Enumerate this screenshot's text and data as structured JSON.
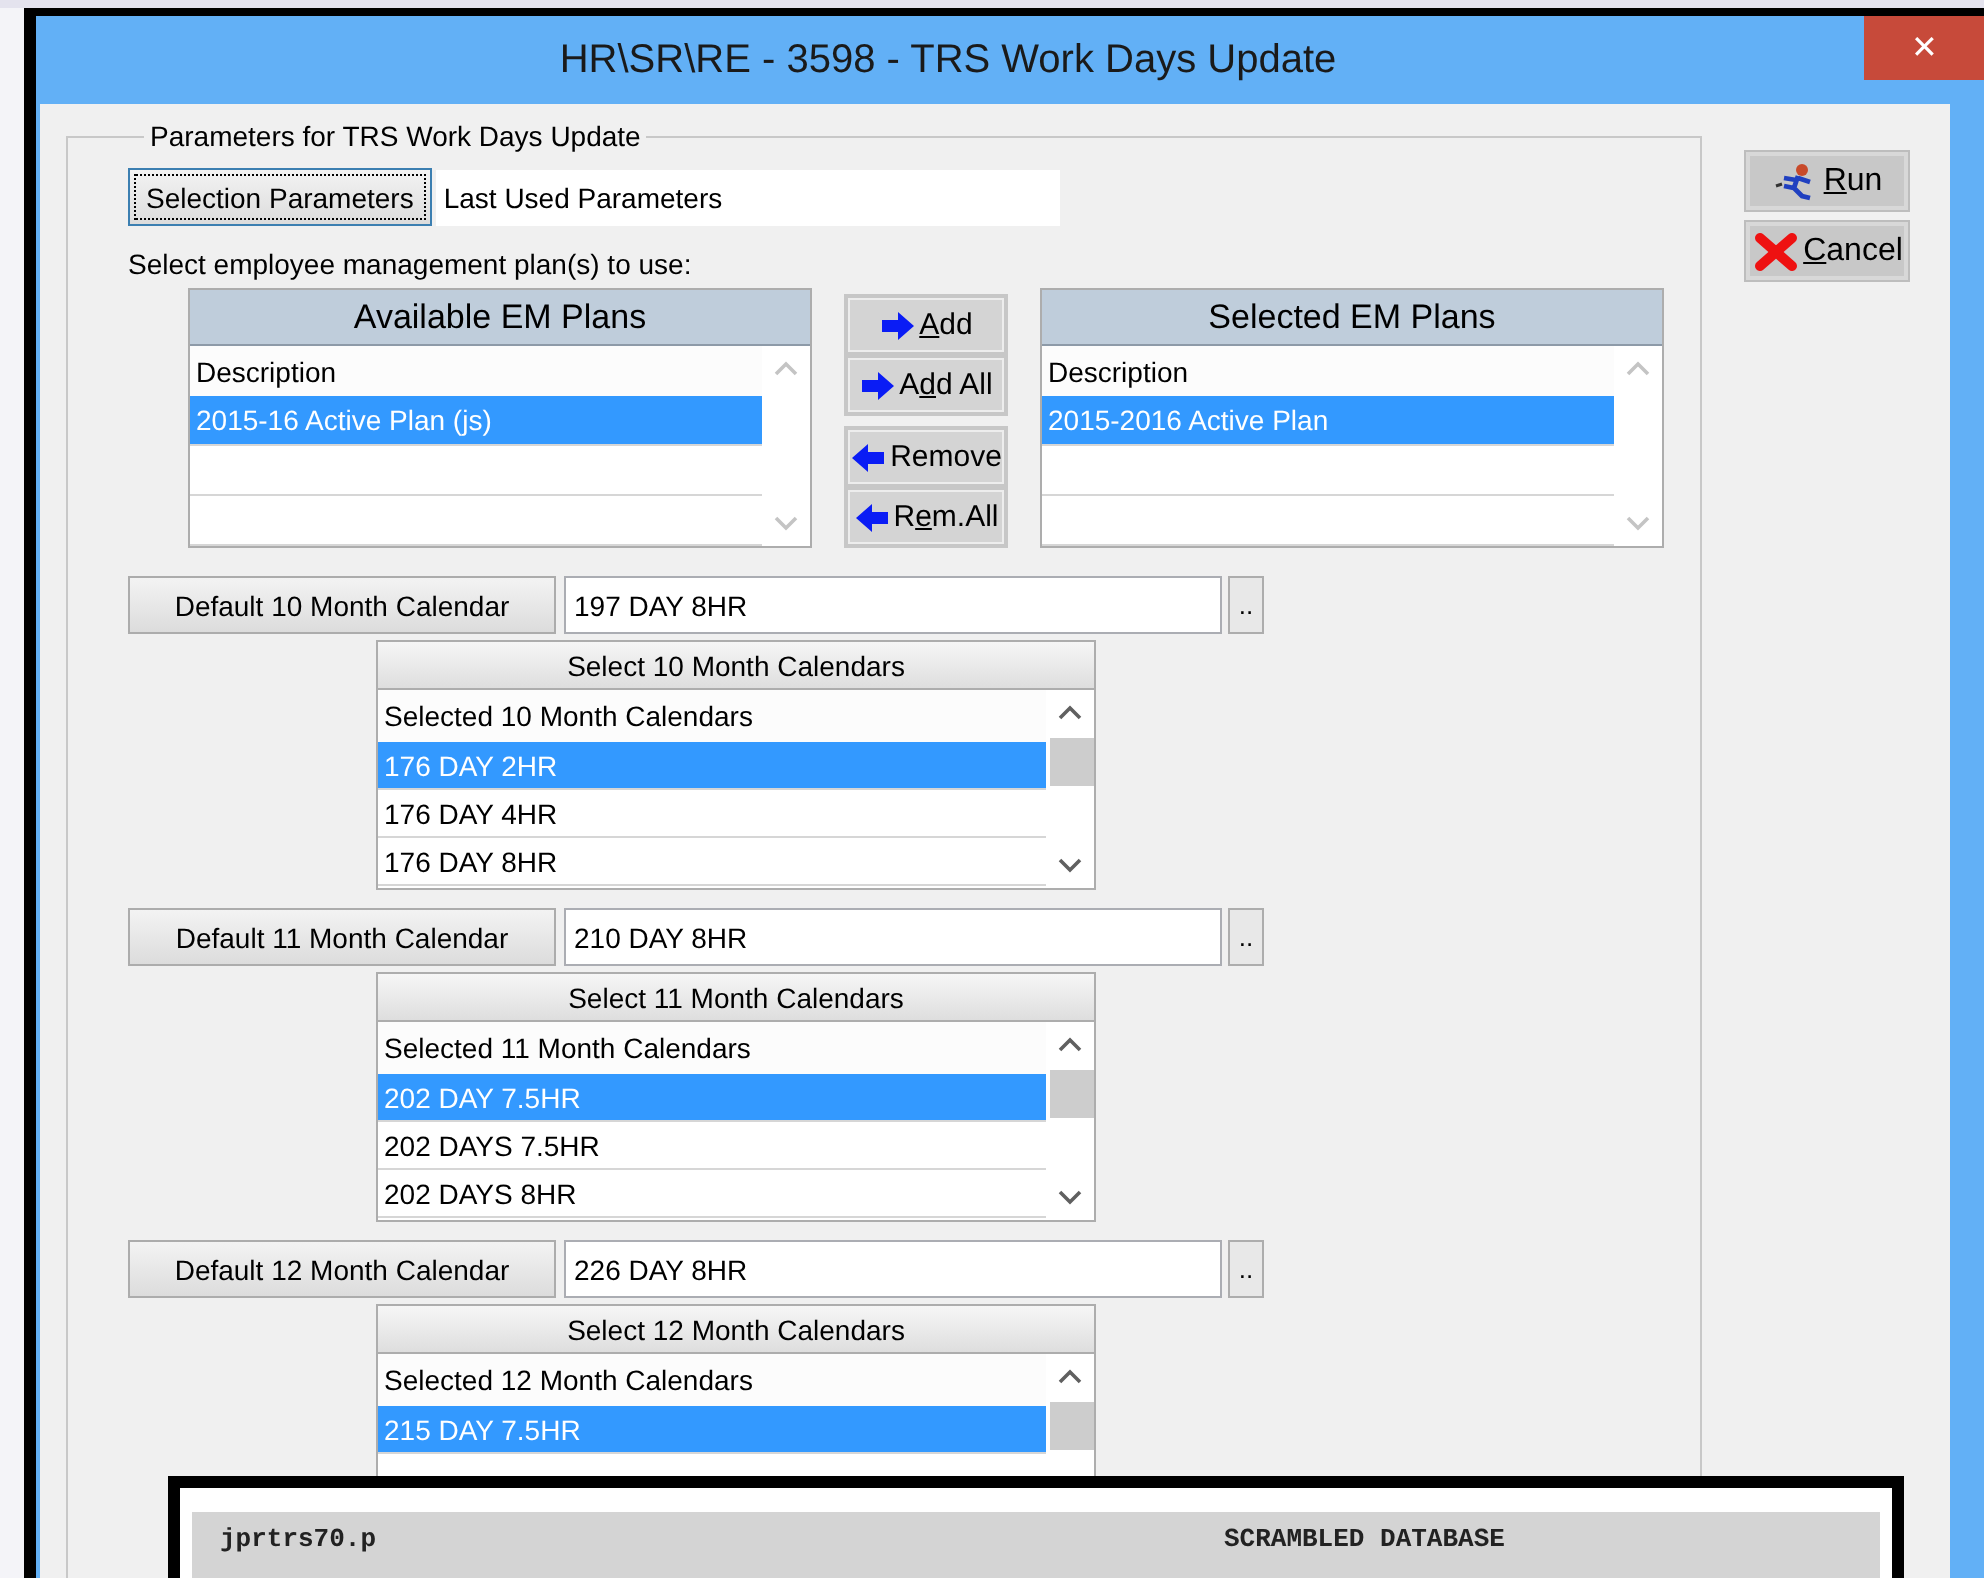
{
  "window": {
    "title": "HR\\SR\\RE - 3598 - TRS Work Days Update",
    "close": "✕"
  },
  "group": {
    "legend": "Parameters for TRS Work Days Update"
  },
  "selection": {
    "button": "Selection Parameters",
    "value": "Last Used Parameters"
  },
  "plans_label": "Select employee management plan(s) to use:",
  "available_plans": {
    "title": "Available EM Plans",
    "column": "Description",
    "rows": [
      {
        "text": "2015-16 Active Plan (js)",
        "selected": true
      }
    ]
  },
  "transfer_buttons": [
    {
      "key": "A",
      "after": "dd",
      "kind": "add"
    },
    {
      "before": "A",
      "key": "d",
      "after": "d All",
      "kind": "add"
    },
    {
      "label": "Remove",
      "kind": "remove"
    },
    {
      "before": "R",
      "key": "e",
      "after": "m.All",
      "kind": "remove"
    }
  ],
  "selected_plans": {
    "title": "Selected EM Plans",
    "column": "Description",
    "rows": [
      {
        "text": "2015-2016 Active Plan",
        "selected": true
      }
    ]
  },
  "calendars": [
    {
      "default_label": "Default 10 Month Calendar",
      "value": "197 DAY 8HR",
      "browse": "..",
      "list_title": "Select 10 Month Calendars",
      "column": "Selected 10 Month Calendars",
      "rows": [
        {
          "text": "176 DAY 2HR",
          "selected": true
        },
        {
          "text": "176 DAY 4HR",
          "selected": false
        },
        {
          "text": "176 DAY 8HR",
          "selected": false
        }
      ]
    },
    {
      "default_label": "Default 11 Month Calendar",
      "value": "210 DAY 8HR",
      "browse": "..",
      "list_title": "Select 11 Month Calendars",
      "column": "Selected 11 Month Calendars",
      "rows": [
        {
          "text": "202 DAY 7.5HR",
          "selected": true
        },
        {
          "text": "202 DAYS 7.5HR",
          "selected": false
        },
        {
          "text": "202 DAYS 8HR",
          "selected": false
        }
      ]
    },
    {
      "default_label": "Default 12 Month Calendar",
      "value": "226 DAY 8HR",
      "browse": "..",
      "list_title": "Select 12 Month Calendars",
      "column": "Selected 12 Month Calendars",
      "rows": [
        {
          "text": "215 DAY 7.5HR",
          "selected": true
        }
      ]
    }
  ],
  "actions": [
    {
      "key": "R",
      "after": "un",
      "kind": "run"
    },
    {
      "key": "C",
      "after": "ancel",
      "kind": "cancel"
    }
  ],
  "report": {
    "program": "jprtrs70.p",
    "banner": "SCRAMBLED DATABASE"
  }
}
